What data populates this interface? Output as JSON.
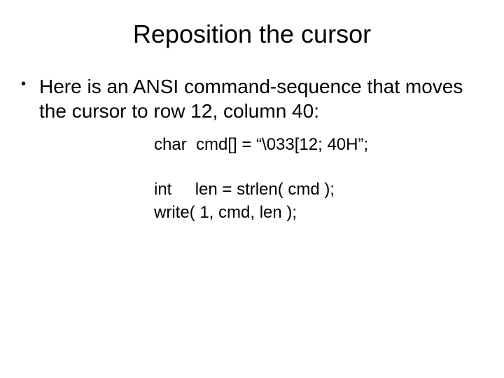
{
  "title": "Reposition the cursor",
  "bullet": {
    "dot": "•",
    "text": "Here is an ANSI command-sequence that moves the cursor to row 12, column 40:"
  },
  "code": {
    "line1": "char  cmd[] = “\\033[12; 40H”;",
    "line2": "int     len = strlen( cmd );",
    "line3": "write( 1, cmd, len );"
  }
}
